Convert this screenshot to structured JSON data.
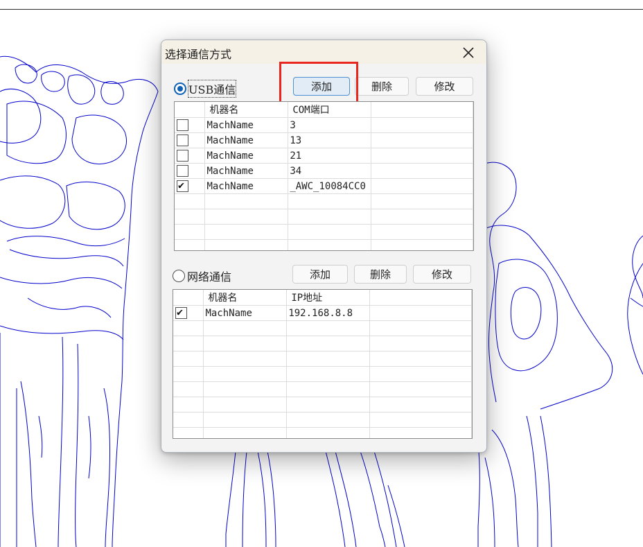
{
  "dialog": {
    "title": "选择通信方式",
    "usb": {
      "label": "USB通信",
      "selected": true,
      "buttons": {
        "add": "添加",
        "delete": "删除",
        "modify": "修改"
      },
      "columns": [
        "",
        "机器名",
        "COM端口"
      ],
      "rows": [
        {
          "checked": false,
          "name": "MachName",
          "port": "3"
        },
        {
          "checked": false,
          "name": "MachName",
          "port": "13"
        },
        {
          "checked": false,
          "name": "MachName",
          "port": "21"
        },
        {
          "checked": false,
          "name": "MachName",
          "port": "34"
        },
        {
          "checked": true,
          "name": "MachName",
          "port": "_AWC_10084CC0"
        }
      ]
    },
    "network": {
      "label": "网络通信",
      "selected": false,
      "buttons": {
        "add": "添加",
        "delete": "删除",
        "modify": "修改"
      },
      "columns": [
        "",
        "机器名",
        "IP地址"
      ],
      "rows": [
        {
          "checked": true,
          "name": "MachName",
          "ip": "192.168.8.8"
        }
      ]
    }
  },
  "icons": {
    "close": "close-icon",
    "check": "check-icon"
  },
  "colors": {
    "accent": "#0f5fb5",
    "highlight": "#e8251f",
    "outline_art": "#0000cc"
  }
}
